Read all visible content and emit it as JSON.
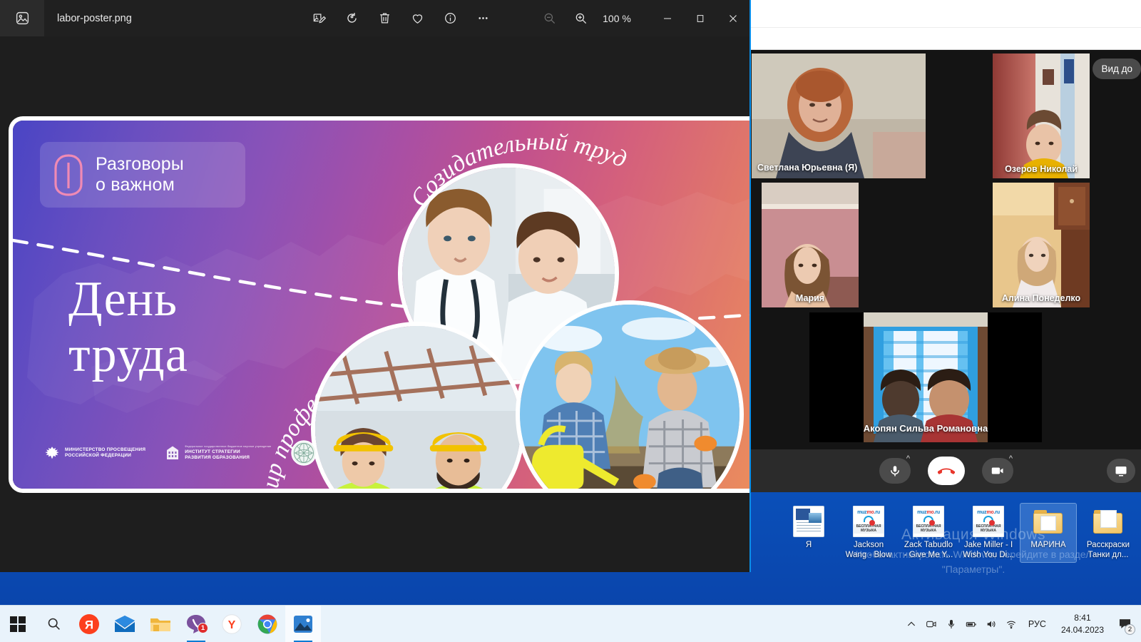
{
  "window": {
    "app_icon": "photo-icon",
    "filename": "labor-poster.png",
    "zoom_level": "100 %",
    "toolbar": [
      {
        "name": "edit-image-icon",
        "label": "Edit image"
      },
      {
        "name": "rotate-icon",
        "label": "Rotate"
      },
      {
        "name": "delete-icon",
        "label": "Delete"
      },
      {
        "name": "favorite-icon",
        "label": "Add to favourites"
      },
      {
        "name": "info-icon",
        "label": "File info"
      },
      {
        "name": "more-options-icon",
        "label": "See more"
      }
    ],
    "zoom_out_label": "Zoom out",
    "zoom_in_label": "Zoom in",
    "minimize_label": "Minimize",
    "maximize_label": "Maximize",
    "close_label": "Close"
  },
  "poster": {
    "badge_line1": "Разговоры",
    "badge_line2": "о важном",
    "title_line1": "День",
    "title_line2": "труда",
    "script_top": "Созидательный труд",
    "script_left": "Мир профессий",
    "logos": [
      {
        "name": "ministry-of-education-logo",
        "sup": "",
        "line1": "МИНИСТЕРСТВО ПРОСВЕЩЕНИЯ",
        "line2": "РОССИЙСКОЙ ФЕДЕРАЦИИ"
      },
      {
        "name": "institute-strategy-logo",
        "sup": "Федеральное государственное бюджетное научное учреждение",
        "line1": "ИНСТИТУТ СТРАТЕГИИ",
        "line2": "РАЗВИТИЯ ОБРАЗОВАНИЯ"
      },
      {
        "name": "round-emblem-logo",
        "sup": "",
        "line1": "",
        "line2": ""
      }
    ],
    "colors": {
      "gradient_start": "#4a45c4",
      "gradient_mid": "#c2518d",
      "gradient_end": "#f0a070",
      "badge_accent": "#ef7fae"
    }
  },
  "conference": {
    "tooltip": "Вид до",
    "participants": [
      {
        "name": "Светлана Юрьевна (Я)",
        "active": true
      },
      {
        "name": "Озеров Николай",
        "active": false
      },
      {
        "name": "Мария",
        "active": false
      },
      {
        "name": "Алина Понеделко",
        "active": false
      },
      {
        "name": "Акопян Сильва Романовна",
        "active": false
      }
    ],
    "active_border_color": "#3bd425",
    "controls": [
      {
        "name": "microphone-button",
        "label": "Микрофон",
        "has_chevron": true
      },
      {
        "name": "end-call-button",
        "label": "Завершить вызов",
        "has_chevron": false
      },
      {
        "name": "camera-button",
        "label": "Камера",
        "has_chevron": true
      },
      {
        "name": "share-screen-button",
        "label": "Демонстрация экрана",
        "has_chevron": false
      }
    ]
  },
  "desktop": {
    "activation_title": "Активация Windows",
    "activation_subtitle": "Чтобы активировать Windows, перейдите в раздел \"Параметры\".",
    "icons": [
      {
        "name": "desktop-icon-ya",
        "label": "Я",
        "type": "doc",
        "selected": false
      },
      {
        "name": "desktop-icon-jackson-wang",
        "label": "Jackson Wang - Blow",
        "type": "mp3",
        "selected": false
      },
      {
        "name": "desktop-icon-zack-tabudlo",
        "label": "Zack Tabudlo - Give Me Y...",
        "type": "mp3",
        "selected": false
      },
      {
        "name": "desktop-icon-jake-miller",
        "label": "Jake Miller - I Wish You Di...",
        "type": "mp3",
        "selected": false
      },
      {
        "name": "desktop-icon-marina-folder",
        "label": "МАРИНА",
        "type": "folder",
        "selected": true
      },
      {
        "name": "desktop-icon-raskraski-folder",
        "label": "Расскраски Танки дл...",
        "type": "folder",
        "selected": false
      }
    ]
  },
  "taskbar": {
    "items": [
      {
        "name": "start-button",
        "label": "Пуск",
        "icon": "windows-icon",
        "state": ""
      },
      {
        "name": "search-button",
        "label": "Поиск",
        "icon": "search-icon",
        "state": ""
      },
      {
        "name": "taskbar-yandex",
        "label": "Яндекс",
        "icon": "yandex-icon",
        "state": ""
      },
      {
        "name": "taskbar-mail",
        "label": "Почта",
        "icon": "mail-icon",
        "state": ""
      },
      {
        "name": "taskbar-explorer",
        "label": "Проводник",
        "icon": "folder-icon",
        "state": ""
      },
      {
        "name": "taskbar-viber",
        "label": "Viber",
        "icon": "viber-icon",
        "state": "running",
        "badge": "1"
      },
      {
        "name": "taskbar-yandex-browser",
        "label": "Яндекс Браузер",
        "icon": "yandex-y-icon",
        "state": ""
      },
      {
        "name": "taskbar-chrome",
        "label": "Google Chrome",
        "icon": "chrome-icon",
        "state": ""
      },
      {
        "name": "taskbar-photos",
        "label": "Фотографии",
        "icon": "photos-icon",
        "state": "active"
      }
    ],
    "tray": [
      {
        "name": "tray-show-hidden-icon",
        "label": "Отображать скрытые значки"
      },
      {
        "name": "tray-camera-icon",
        "label": "Камера"
      },
      {
        "name": "tray-microphone-icon",
        "label": "Микрофон"
      },
      {
        "name": "tray-battery-icon",
        "label": "Батарея"
      },
      {
        "name": "tray-volume-icon",
        "label": "Громкость"
      },
      {
        "name": "tray-wifi-icon",
        "label": "Сеть"
      }
    ],
    "language": "РУС",
    "time": "8:41",
    "date": "24.04.2023",
    "notification_count": "2"
  }
}
